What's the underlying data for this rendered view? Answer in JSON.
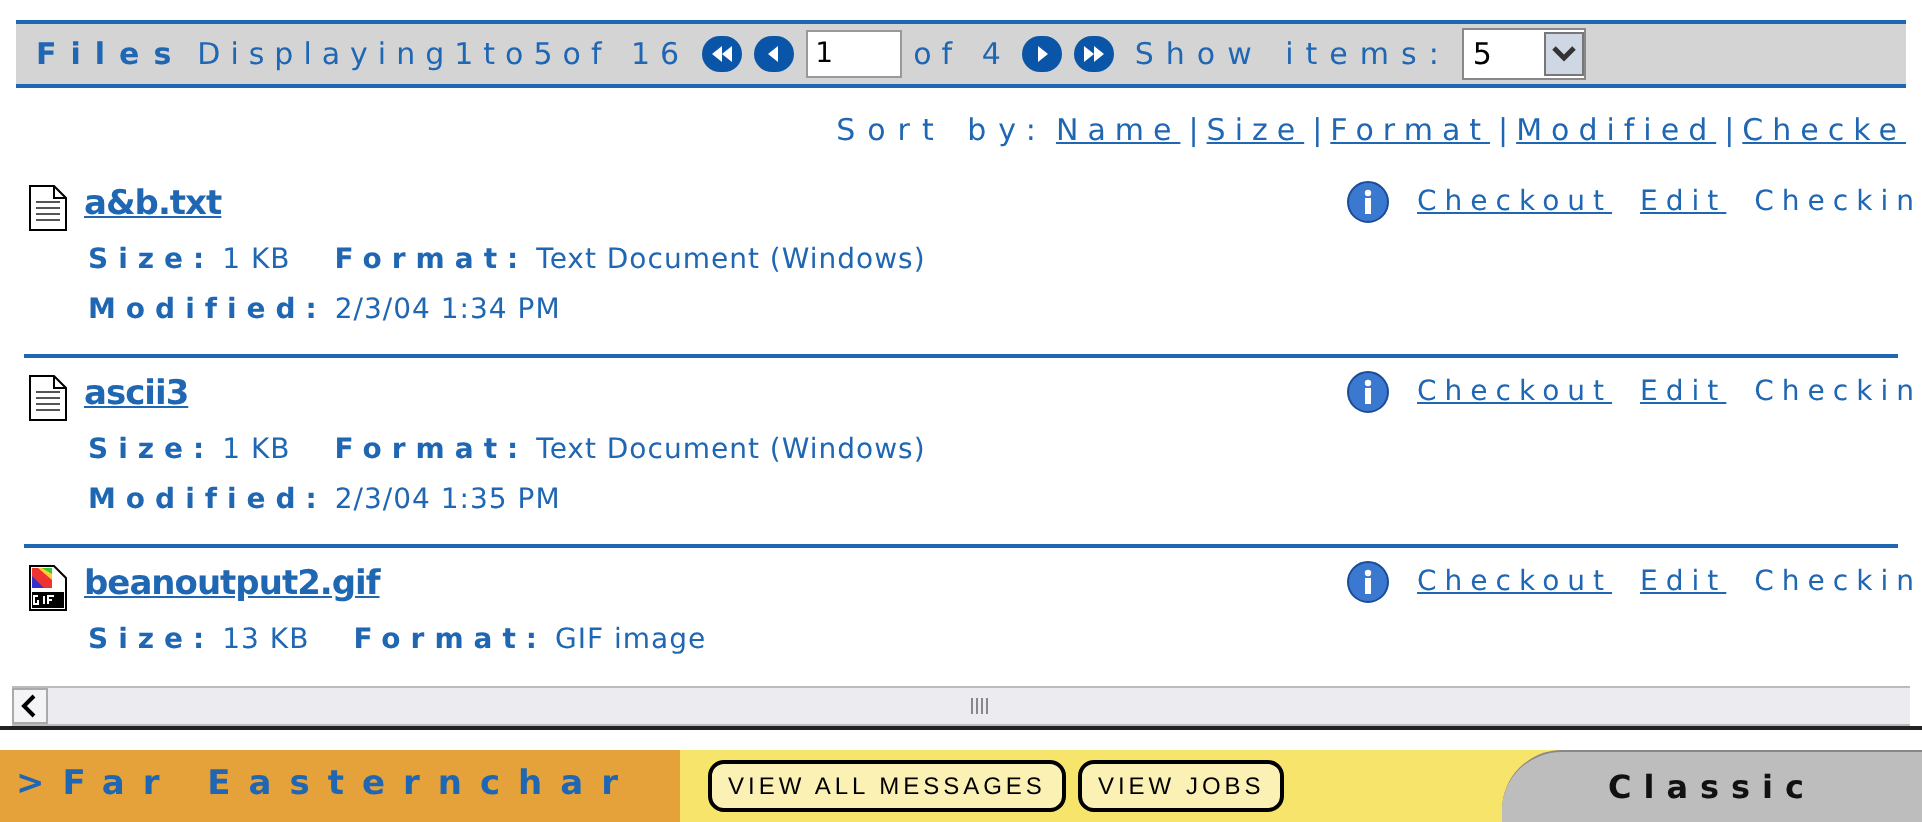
{
  "toolbar": {
    "title": "Files",
    "display_text": "Displaying1to5of 16",
    "page_value": "1",
    "of_pages": "of 4",
    "show_items_label": "Show items:",
    "show_items_value": "5"
  },
  "sort": {
    "label": "Sort by:",
    "separator": "|",
    "links": [
      "Name",
      "Size",
      "Format",
      "Modified",
      "Checke"
    ]
  },
  "files": [
    {
      "kind": "text",
      "name": "a&b.txt",
      "size_label": "Size:",
      "size": "1 KB",
      "format_label": "Format:",
      "format": "Text Document (Windows)",
      "modified_label": "Modified:",
      "modified": "2/3/04 1:34 PM",
      "actions": [
        {
          "label": "Checkout",
          "link": true
        },
        {
          "label": "Edit",
          "link": true
        },
        {
          "label": "Checkin",
          "link": false
        }
      ]
    },
    {
      "kind": "text",
      "name": "ascii3",
      "size_label": "Size:",
      "size": "1 KB",
      "format_label": "Format:",
      "format": "Text Document (Windows)",
      "modified_label": "Modified:",
      "modified": "2/3/04 1:35 PM",
      "actions": [
        {
          "label": "Checkout",
          "link": true
        },
        {
          "label": "Edit",
          "link": true
        },
        {
          "label": "Checkin",
          "link": false
        }
      ]
    },
    {
      "kind": "gif",
      "name": "beanoutput2.gif",
      "size_label": "Size:",
      "size": "13 KB",
      "format_label": "Format:",
      "format": "GIF image",
      "actions": [
        {
          "label": "Checkout",
          "link": true
        },
        {
          "label": "Edit",
          "link": true
        },
        {
          "label": "Checkin",
          "link": false
        }
      ]
    }
  ],
  "footer": {
    "marquee": ">Far Easternchar",
    "buttons": [
      "VIEW ALL MESSAGES",
      "VIEW JOBS"
    ],
    "tab": "Classic"
  }
}
